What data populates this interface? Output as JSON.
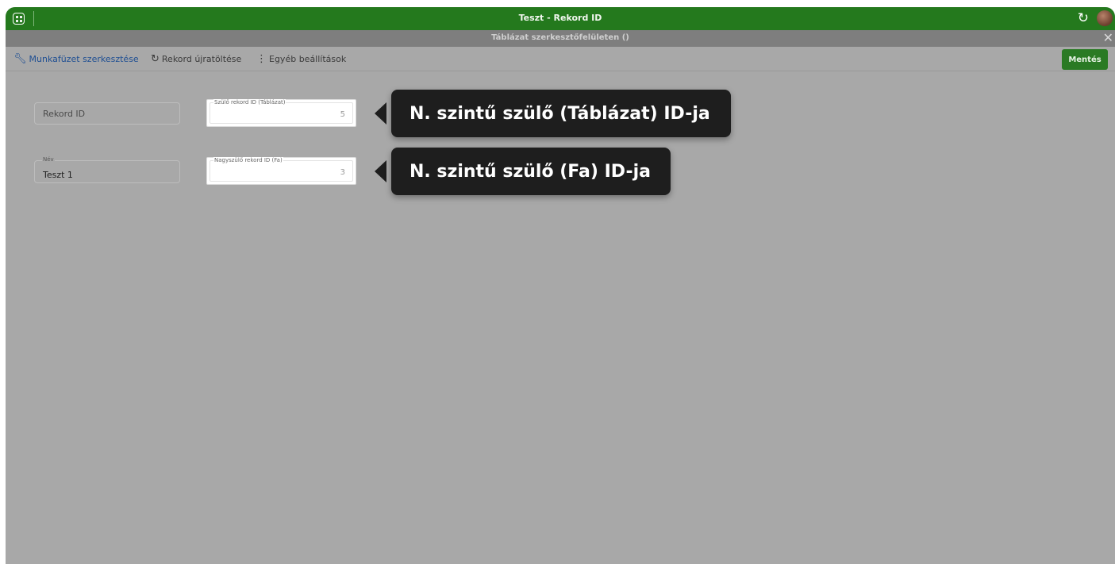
{
  "window": {
    "title": "Teszt - Rekord ID",
    "subtitle": "Táblázat szerkesztőfelületen ()"
  },
  "toolbar": {
    "edit_workbook": "Munkafüzet szerkesztése",
    "reload_record": "Rekord újratöltése",
    "more_settings": "Egyéb beállítások",
    "save": "Mentés"
  },
  "form": {
    "record_id_label": "Rekord ID",
    "name_label": "Név",
    "name_value": "Teszt 1",
    "parent_id_label": "Szülő rekord ID (Táblázat)",
    "parent_id_value": "5",
    "grandparent_id_label": "Nagyszülő rekord ID (Fa)",
    "grandparent_id_value": "3"
  },
  "callouts": {
    "parent": "N. szintű szülő (Táblázat) ID-ja",
    "grandparent": "N. szintű szülő (Fa) ID-ja"
  },
  "icons": {
    "apps": "apps-icon",
    "refresh": "refresh-icon",
    "close": "close-icon",
    "wrench": "wrench-icon",
    "reload": "reload-icon",
    "more": "more-vertical-icon"
  },
  "colors": {
    "titlebar": "#24791d",
    "save_button": "#2a7a24",
    "callout_bg": "#1e1e1e",
    "overlay": "#a8a8a8"
  }
}
